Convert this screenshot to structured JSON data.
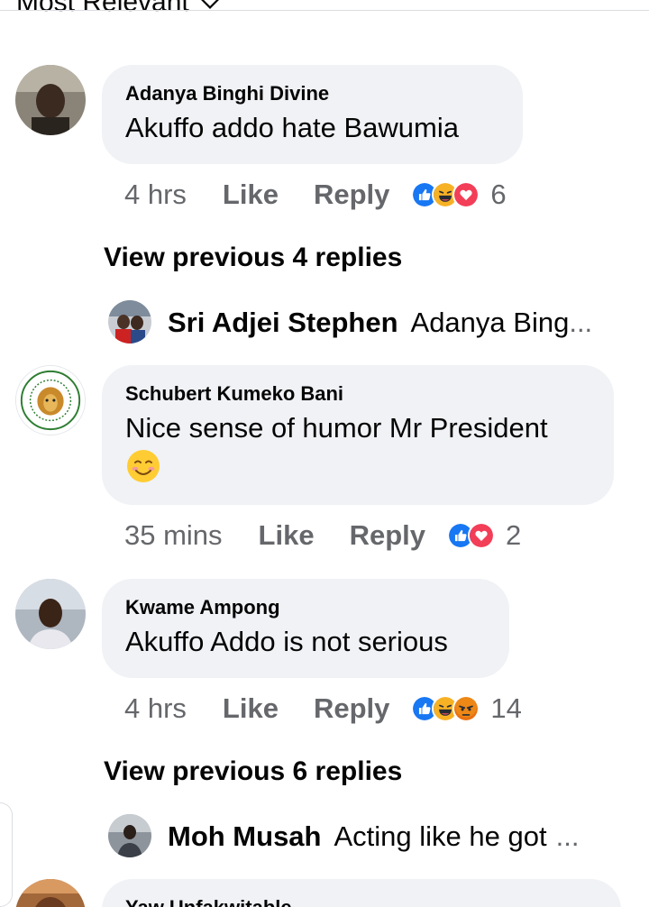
{
  "sort": {
    "label": "Most Relevant"
  },
  "comments": [
    {
      "name": "Adanya Binghi Divine",
      "text": "Akuffo addo hate Bawumia",
      "time": "4 hrs",
      "like": "Like",
      "reply": "Reply",
      "reactions": [
        "like",
        "haha",
        "love"
      ],
      "reaction_count": "6",
      "view_previous": "View previous 4 replies",
      "latest_reply": {
        "name": "Sri Adjei Stephen",
        "text": "Adanya Bing",
        "ellipsis": "..."
      }
    },
    {
      "name": "Schubert Kumeko Bani",
      "text": "Nice sense of humor Mr President",
      "emoji": "😊",
      "time": "35 mins",
      "like": "Like",
      "reply": "Reply",
      "reactions": [
        "like",
        "love"
      ],
      "reaction_count": "2"
    },
    {
      "name": "Kwame Ampong",
      "text": "Akuffo Addo is not serious",
      "time": "4 hrs",
      "like": "Like",
      "reply": "Reply",
      "reactions": [
        "like",
        "haha",
        "angry"
      ],
      "reaction_count": "14",
      "view_previous": "View previous 6 replies",
      "latest_reply": {
        "name": "Moh Musah",
        "text": "Acting like he got",
        "ellipsis": "..."
      }
    },
    {
      "name": "Yaw Unfakwitable"
    }
  ],
  "colors": {
    "bubble": "#f0f2f5",
    "meta": "#65676b",
    "like_blue": "#1877f2",
    "love_red": "#f33e58",
    "haha_yellow": "#f7b125",
    "angry_orange": "#e9710f"
  }
}
